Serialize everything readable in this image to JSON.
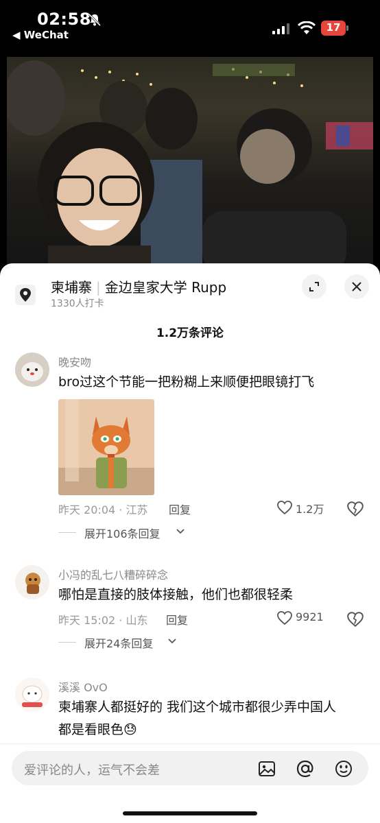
{
  "status_bar": {
    "time": "02:58",
    "back_app": "◀ WeChat",
    "battery": "17"
  },
  "location": {
    "title_part1": "柬埔寨",
    "title_part2": "金边皇家大学 Rupp",
    "checkins": "1330人打卡",
    "icon": "location-pin-icon"
  },
  "comments_header": "1.2万条评论",
  "comments": [
    {
      "user": "晚安吻",
      "text": "bro过这个节能一把粉糊上来顺便把眼镜打飞",
      "time_loc": "昨天 20:04 · 江苏",
      "reply": "回复",
      "likes": "1.2万",
      "expand": "展开106条回复",
      "has_sticker": true
    },
    {
      "user": "小冯的乱七八糟碎碎念",
      "text": "哪怕是直接的肢体接触，他们也都很轻柔",
      "time_loc": "昨天 15:02 · 山东",
      "reply": "回复",
      "likes": "9921",
      "expand": "展开24条回复"
    },
    {
      "user": "溪溪 OvO",
      "text_line1": "柬埔寨人都挺好的 我们这个城市都很少弄中国人",
      "text_line2": "都是看眼色😓"
    }
  ],
  "input_bar": {
    "placeholder": "爱评论的人，运气不会差",
    "icons": [
      "image-icon",
      "at-icon",
      "emoji-icon"
    ]
  },
  "colors": {
    "accent_red": "#e6463c",
    "sheet_bg": "#ffffff",
    "muted_text": "#999999"
  }
}
